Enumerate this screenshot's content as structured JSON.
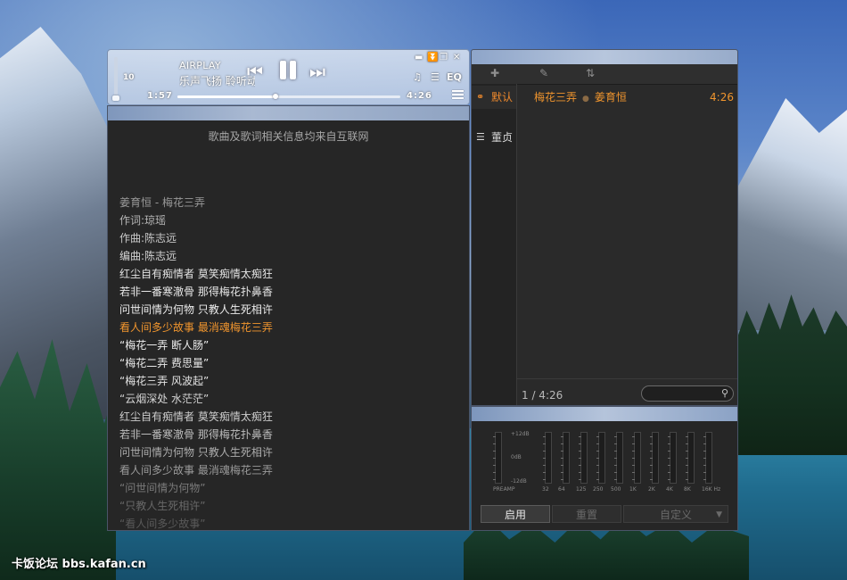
{
  "desktop": {
    "watermark": "卡饭论坛 bbs.kafan.cn"
  },
  "player": {
    "volume_label": "10",
    "source": "AIRPLAY",
    "title_scroll": "乐声飞扬  聆听动人",
    "time_current": "1:57",
    "time_total": "4:26",
    "progress_fraction": 0.44,
    "eq_label": "EQ",
    "icons": {
      "previous": "previous-icon",
      "pause": "pause-icon",
      "next": "next-icon",
      "minimize": "minimize-icon",
      "mini_mode": "mini-mode-icon",
      "restore": "restore-icon",
      "close": "close-icon",
      "lyrics_toggle": "lyrics-icon",
      "playlist_toggle": "playlist-icon",
      "menu": "menu-icon"
    },
    "colors": {
      "text": "#ffffff"
    }
  },
  "lyrics": {
    "source_note": "歌曲及歌词相关信息均来自互联网",
    "highlight_color": "#f0952e",
    "lines": [
      {
        "text": "姜育恒 - 梅花三弄",
        "color": "#9a9a9a"
      },
      {
        "text": "作词:琼瑶",
        "color": "#b5b5b5"
      },
      {
        "text": "作曲:陈志远",
        "color": "#c8c8c8"
      },
      {
        "text": "编曲:陈志远",
        "color": "#d4d4d4"
      },
      {
        "text": "红尘自有痴情者 莫笑痴情太痴狂",
        "color": "#e2e2e2"
      },
      {
        "text": "若非一番寒澈骨 那得梅花扑鼻香",
        "color": "#e8e8e8"
      },
      {
        "text": "问世间情为何物 只教人生死相许",
        "color": "#ececec"
      },
      {
        "text": "看人间多少故事 最消魂梅花三弄",
        "color": "#f0952e"
      },
      {
        "text": "“梅花一弄 断人肠”",
        "color": "#ececec"
      },
      {
        "text": "“梅花二弄 费思量”",
        "color": "#e8e8e8"
      },
      {
        "text": "“梅花三弄 风波起”",
        "color": "#e2e2e2"
      },
      {
        "text": "“云烟深处 水茫茫”",
        "color": "#d6d6d6"
      },
      {
        "text": "红尘自有痴情者 莫笑痴情太痴狂",
        "color": "#cccccc"
      },
      {
        "text": "若非一番寒澈骨 那得梅花扑鼻香",
        "color": "#bdbdbd"
      },
      {
        "text": "问世间情为何物 只教人生死相许",
        "color": "#adadad"
      },
      {
        "text": "看人间多少故事 最消魂梅花三弄",
        "color": "#9a9a9a"
      },
      {
        "text": "“问世间情为何物”",
        "color": "#7a7a7a"
      },
      {
        "text": "“只教人生死相许”",
        "color": "#686868"
      },
      {
        "text": "“看人间多少故事”",
        "color": "#5a5a5a"
      }
    ]
  },
  "playlist": {
    "toolbar_icons": [
      "add-icon",
      "edit-icon",
      "sort-icon"
    ],
    "tabs": [
      {
        "label": "默认",
        "icon": "headphones-icon",
        "active": true
      },
      {
        "label": "董贞",
        "icon": "list-icon",
        "active": false
      }
    ],
    "tracks": [
      {
        "title": "梅花三弄",
        "artist": "姜育恒",
        "duration": "4:26"
      }
    ],
    "status": "1 / 4:26",
    "search_placeholder": "",
    "colors": {
      "accent": "#f0952e"
    }
  },
  "equalizer": {
    "db_labels": [
      "+12dB",
      "0dB",
      "-12dB"
    ],
    "bands": [
      "PREAMP",
      "32",
      "64",
      "125",
      "250",
      "500",
      "1K",
      "2K",
      "4K",
      "8K",
      "16K Hz"
    ],
    "buttons": {
      "enable": "启用",
      "reset": "重置",
      "preset": "自定义"
    }
  }
}
